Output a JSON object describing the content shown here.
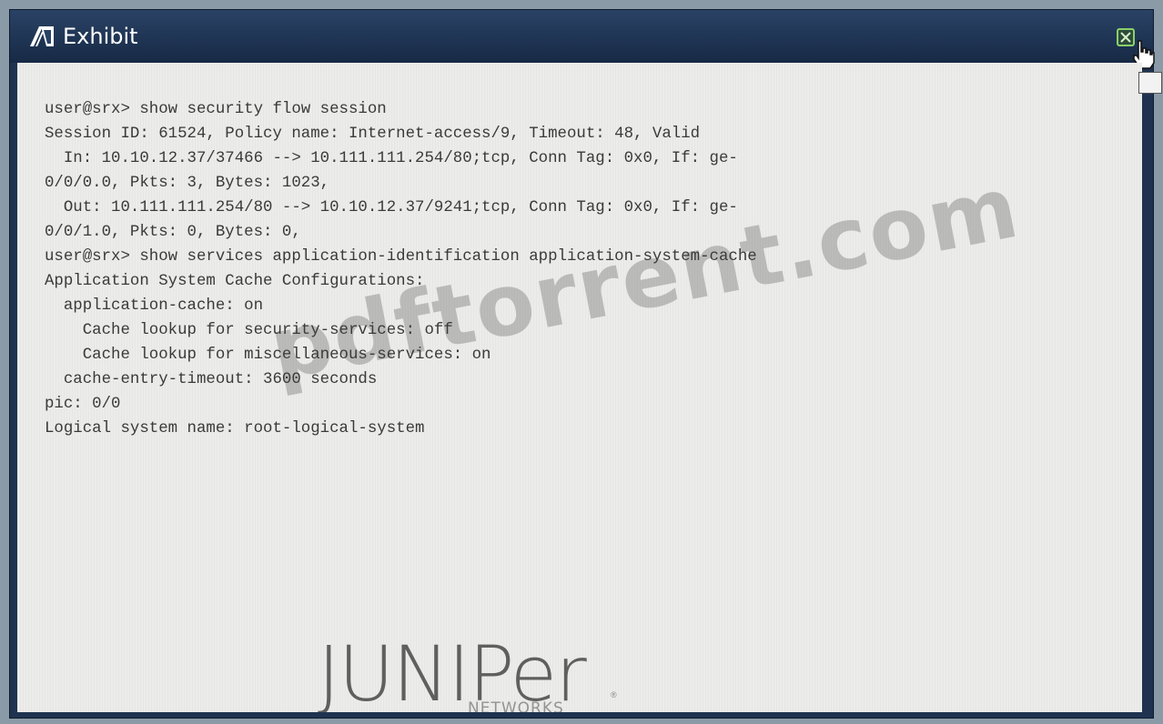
{
  "window": {
    "title": "Exhibit",
    "title_icon": "exhibit-tent-icon",
    "close_icon": "close-icon",
    "cursor_icon": "hand-pointer-icon",
    "accent_color": "#1f3350"
  },
  "terminal": {
    "lines": [
      "user@srx> show security flow session",
      "Session ID: 61524, Policy name: Internet-access/9, Timeout: 48, Valid",
      "  In: 10.10.12.37/37466 --> 10.111.111.254/80;tcp, Conn Tag: 0x0, If: ge-",
      "0/0/0.0, Pkts: 3, Bytes: 1023,",
      "  Out: 10.111.111.254/80 --> 10.10.12.37/9241;tcp, Conn Tag: 0x0, If: ge-",
      "0/0/1.0, Pkts: 0, Bytes: 0,",
      "user@srx> show services application-identification application-system-cache",
      "Application System Cache Configurations:",
      "  application-cache: on",
      "    Cache lookup for security-services: off",
      "    Cache lookup for miscellaneous-services: on",
      "  cache-entry-timeout: 3600 seconds",
      "pic: 0/0",
      "Logical system name: root-logical-system"
    ]
  },
  "watermark": {
    "text": "pdftorrent.com"
  },
  "logo": {
    "name": "JUNIPer",
    "sub": "NETWORKS",
    "registered": "®"
  }
}
